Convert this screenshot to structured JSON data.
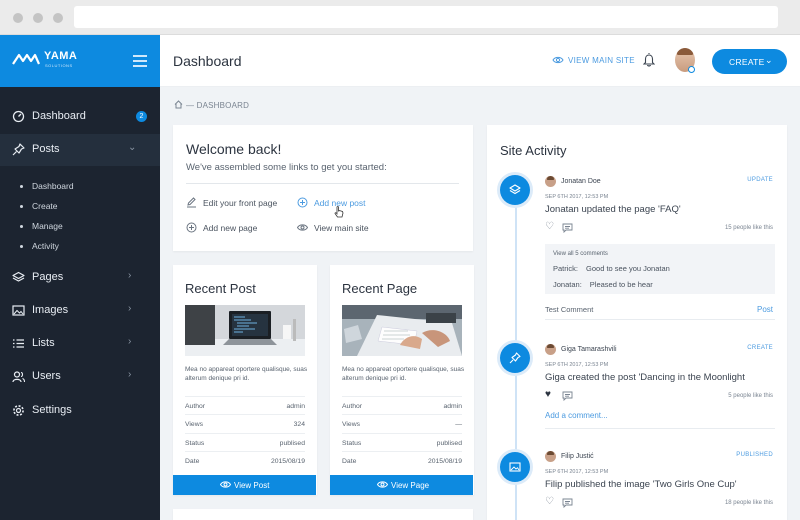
{
  "sidebar": {
    "brand": {
      "name": "YAMA",
      "tagline": "SOLUTIONS"
    },
    "nav": [
      {
        "label": "Dashboard",
        "icon": "gauge-icon",
        "badge": "2"
      },
      {
        "label": "Posts",
        "icon": "pin-icon"
      },
      {
        "label": "Pages",
        "icon": "layers-icon"
      },
      {
        "label": "Images",
        "icon": "image-icon"
      },
      {
        "label": "Lists",
        "icon": "list-icon"
      },
      {
        "label": "Users",
        "icon": "users-icon"
      },
      {
        "label": "Settings",
        "icon": "gear-icon"
      }
    ],
    "posts_submenu": [
      "Dashboard",
      "Create",
      "Manage",
      "Activity"
    ]
  },
  "header": {
    "title": "Dashboard",
    "view_main_site": "VIEW MAIN SITE",
    "create_label": "CREATE"
  },
  "breadcrumb": "— DASHBOARD",
  "welcome": {
    "title": "Welcome back!",
    "subtitle": "We've assembled some links to get you started:",
    "links": [
      "Edit your front page",
      "Add new post",
      "Add new page",
      "View main site"
    ]
  },
  "recent_post": {
    "title": "Recent Post",
    "desc": "Mea no apparеat oportere qualisque, suas alterum denique pri id.",
    "meta": [
      {
        "k": "Author",
        "v": "admin"
      },
      {
        "k": "Views",
        "v": "324"
      },
      {
        "k": "Status",
        "v": "publised"
      },
      {
        "k": "Date",
        "v": "2015/08/19"
      }
    ],
    "button": "View Post"
  },
  "recent_page": {
    "title": "Recent Page",
    "desc": "Mea no apparеat oportere qualisque, suas alterum denique pri id.",
    "meta": [
      {
        "k": "Author",
        "v": "admin"
      },
      {
        "k": "Views",
        "v": "—"
      },
      {
        "k": "Status",
        "v": "publised"
      },
      {
        "k": "Date",
        "v": "2015/08/19"
      }
    ],
    "button": "View Page"
  },
  "activity": {
    "title": "Site Activity",
    "items": [
      {
        "user": "Jonatan Doe",
        "tag": "UPDATE",
        "date": "SEP 6TH 2017, 12:53 PM",
        "text": "Jonatan updated the page 'FAQ'",
        "likes": "15 people like this"
      },
      {
        "user": "Giga Tamarashvili",
        "tag": "CREATE",
        "date": "SEP 6TH 2017, 12:53 PM",
        "text": "Giga created the post 'Dancing in the Moonlight",
        "likes": "5 people like this"
      },
      {
        "user": "Filip Justić",
        "tag": "PUBLISHED",
        "date": "SEP 6TH 2017, 12:53 PM",
        "text": "Filip published the image 'Two Girls One Cup'",
        "likes": "18 people like this"
      }
    ],
    "view_all": "View all 5 comments",
    "comments": [
      {
        "who": "Patrick:",
        "text": "Good to see you Jonatan"
      },
      {
        "who": "Jonatan:",
        "text": "Pleased to be hear"
      }
    ],
    "test_comment": "Test Comment",
    "post_label": "Post",
    "add_comment": "Add a comment..."
  },
  "colors": {
    "accent": "#0d8ae0",
    "sidebar": "#1c2430",
    "background": "#f0f3f6"
  }
}
